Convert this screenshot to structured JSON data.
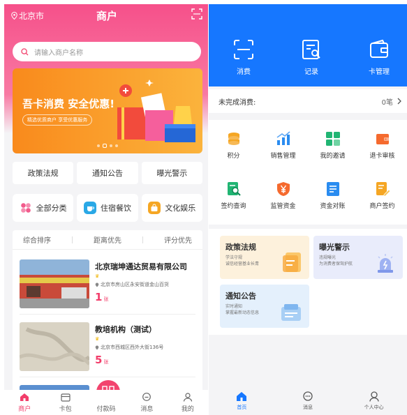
{
  "left": {
    "status": {
      "city": "北京市",
      "title": "商户"
    },
    "search": {
      "placeholder": "请输入商户名称"
    },
    "banner": {
      "title": "吾卡消费 安全优惠!",
      "subtitle": "精选优质商户 享受优惠服务"
    },
    "quick_links": [
      "政策法规",
      "通知公告",
      "曝光警示"
    ],
    "categories": [
      {
        "label": "全部分类",
        "icon": "grid-icon",
        "color": "#f25b8c"
      },
      {
        "label": "住宿餐饮",
        "icon": "cup-icon",
        "color": "#2aa8e6"
      },
      {
        "label": "文化娱乐",
        "icon": "bag-icon",
        "color": "#f5a623"
      }
    ],
    "sort_options": [
      "综合排序",
      "距离优先",
      "评分优先"
    ],
    "merchants": [
      {
        "name": "北京瑞坤通达贸易有限公司",
        "address": "北京市房山区永安街道金山百货",
        "count": "1",
        "unit": "张"
      },
      {
        "name": "教培机构（测试）",
        "address": "北京市西城区西外大街136号",
        "count": "5",
        "unit": "张"
      }
    ],
    "tabbar": [
      {
        "label": "商户",
        "icon": "home-icon",
        "active": true
      },
      {
        "label": "卡包",
        "icon": "card-icon",
        "active": false
      },
      {
        "label": "付款码",
        "icon": "qrcode-icon",
        "active": false
      },
      {
        "label": "消息",
        "icon": "message-icon",
        "active": false
      },
      {
        "label": "我的",
        "icon": "user-icon",
        "active": false
      }
    ],
    "colors": {
      "brand": "#f6508a",
      "accent": "#f23d6a"
    }
  },
  "right": {
    "quick_actions": [
      {
        "label": "消费",
        "icon": "scan-icon"
      },
      {
        "label": "记录",
        "icon": "record-icon"
      },
      {
        "label": "卡管理",
        "icon": "wallet-icon"
      }
    ],
    "pending": {
      "label": "未完成消费:",
      "count": "0笔"
    },
    "grid": [
      {
        "label": "积分",
        "icon": "coins-icon",
        "color": "#f5a623"
      },
      {
        "label": "销售管理",
        "icon": "chart-icon",
        "color": "#2a8cf0"
      },
      {
        "label": "我的邀请",
        "icon": "apps-icon",
        "color": "#21b573"
      },
      {
        "label": "退卡审核",
        "icon": "wallet-icon",
        "color": "#f56a2e"
      },
      {
        "label": "签约查询",
        "icon": "doc-search-icon",
        "color": "#21b573"
      },
      {
        "label": "监管资金",
        "icon": "shield-yuan-icon",
        "color": "#f56a2e"
      },
      {
        "label": "资金对账",
        "icon": "ledger-icon",
        "color": "#2a8cf0"
      },
      {
        "label": "商户签约",
        "icon": "sign-icon",
        "color": "#f5a623"
      }
    ],
    "info_cards": [
      {
        "title": "政策法规",
        "lines": [
          "学法守规",
          "诚信经营基业长青"
        ],
        "icon": "document-icon",
        "bg": "#fdf1dc"
      },
      {
        "title": "曝光警示",
        "lines": [
          "违规曝光",
          "为消费者保驾护航"
        ],
        "icon": "alarm-icon",
        "bg": "#e9ecfb"
      },
      {
        "title": "通知公告",
        "lines": [
          "实时通知",
          "掌握最新动态信息"
        ],
        "icon": "notice-icon",
        "bg": "#e4f0fc"
      }
    ],
    "tabbar": [
      {
        "label": "首页",
        "icon": "home-icon",
        "active": true
      },
      {
        "label": "消息",
        "icon": "message-icon",
        "active": false
      },
      {
        "label": "个人中心",
        "icon": "user-icon",
        "active": false
      }
    ],
    "colors": {
      "brand": "#1677ff"
    }
  }
}
